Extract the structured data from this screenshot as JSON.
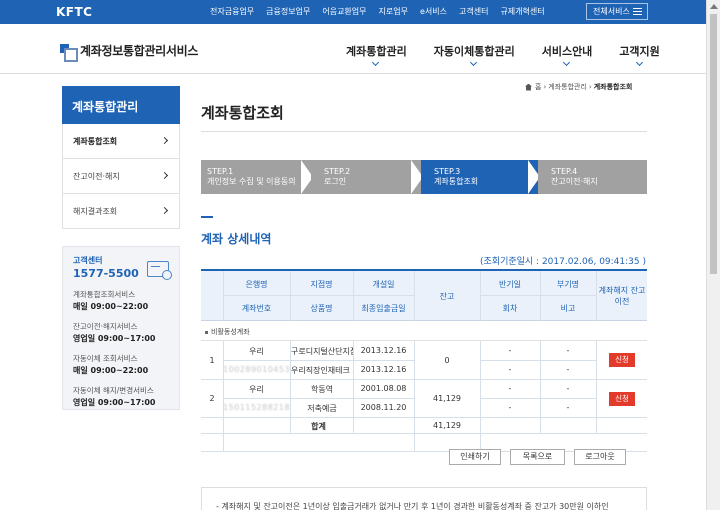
{
  "topbar": {
    "logo": "KFTC",
    "nav": [
      "전자금융업무",
      "금융정보업무",
      "어음교환업무",
      "지로업무",
      "e서비스",
      "고객센터",
      "규제개혁센터"
    ],
    "all_services": "전체서비스"
  },
  "header": {
    "brand": "계좌정보통합관리서비스",
    "nav": [
      "계좌통합관리",
      "자동이체통합관리",
      "서비스안내",
      "고객지원"
    ]
  },
  "breadcrumb": {
    "home": "홈",
    "level1": "계좌통합관리",
    "current": "계좌통합조회"
  },
  "sidebar": {
    "title": "계좌통합관리",
    "items": [
      {
        "label": "계좌통합조회"
      },
      {
        "label": "잔고이전·해지"
      },
      {
        "label": "해지결과조회"
      }
    ]
  },
  "customer_center": {
    "title": "고객센터",
    "phone": "1577-5500",
    "groups": [
      {
        "label": "계좌통합조회서비스",
        "hours": "매일 09:00~22:00"
      },
      {
        "label": "잔고이전·해지서비스",
        "hours": "영업일 09:00~17:00"
      },
      {
        "label": "자동이체 조회서비스",
        "hours": "매일 09:00~22:00"
      },
      {
        "label": "자동이체 해지/변경서비스",
        "hours": "영업일 09:00~17:00"
      }
    ]
  },
  "page_title": "계좌통합조회",
  "steps": [
    {
      "num": "STEP.1",
      "label": "개인정보 수집 및 이용동의"
    },
    {
      "num": "STEP.2",
      "label": "로그인"
    },
    {
      "num": "STEP.3",
      "label": "계좌통합조회"
    },
    {
      "num": "STEP.4",
      "label": "잔고이전·해지"
    }
  ],
  "section_title": "계좌 상세내역",
  "base_date": "(조회기준일시 : 2017.02.06, 09:41:35 )",
  "table": {
    "headers": {
      "bank": "은행명",
      "account_no": "계좌번호",
      "branch": "지점명",
      "product": "상품명",
      "opened": "개설일",
      "last_tx": "최종입출금일",
      "balance": "잔고",
      "half_year": "반기일",
      "round": "회차",
      "suspense": "부기명",
      "note": "비고",
      "action": "계좌해지 잔고이전"
    },
    "group_label": "비활동성계좌",
    "rows": [
      {
        "no": "1",
        "bank": "우리",
        "account": "1002890104534",
        "branch": "구로디지털산단지점",
        "product": "우리직장인재테크 저",
        "opened": "2013.12.16",
        "last_tx": "2013.12.16",
        "balance": "0",
        "half_year": "-",
        "round": "-",
        "suspense": "-",
        "note": "-",
        "action": "신청"
      },
      {
        "no": "2",
        "bank": "우리",
        "account": "1501152882181",
        "branch": "학동역",
        "product": "저축예금",
        "opened": "2001.08.08",
        "last_tx": "2008.11.20",
        "balance": "41,129",
        "half_year": "-",
        "round": "-",
        "suspense": "-",
        "note": "-",
        "action": "신청"
      }
    ],
    "total_label": "합계",
    "total_value": "41,129"
  },
  "actions": {
    "print": "인쇄하기",
    "list": "목록으로",
    "logout": "로그아웃"
  },
  "notice": "- 계좌해지 및 잔고이전은 1년이상 입출금거래가 없거나 만기 후 1년이 경과한 비활동성계좌 중 잔고가 30만원 이하인"
}
